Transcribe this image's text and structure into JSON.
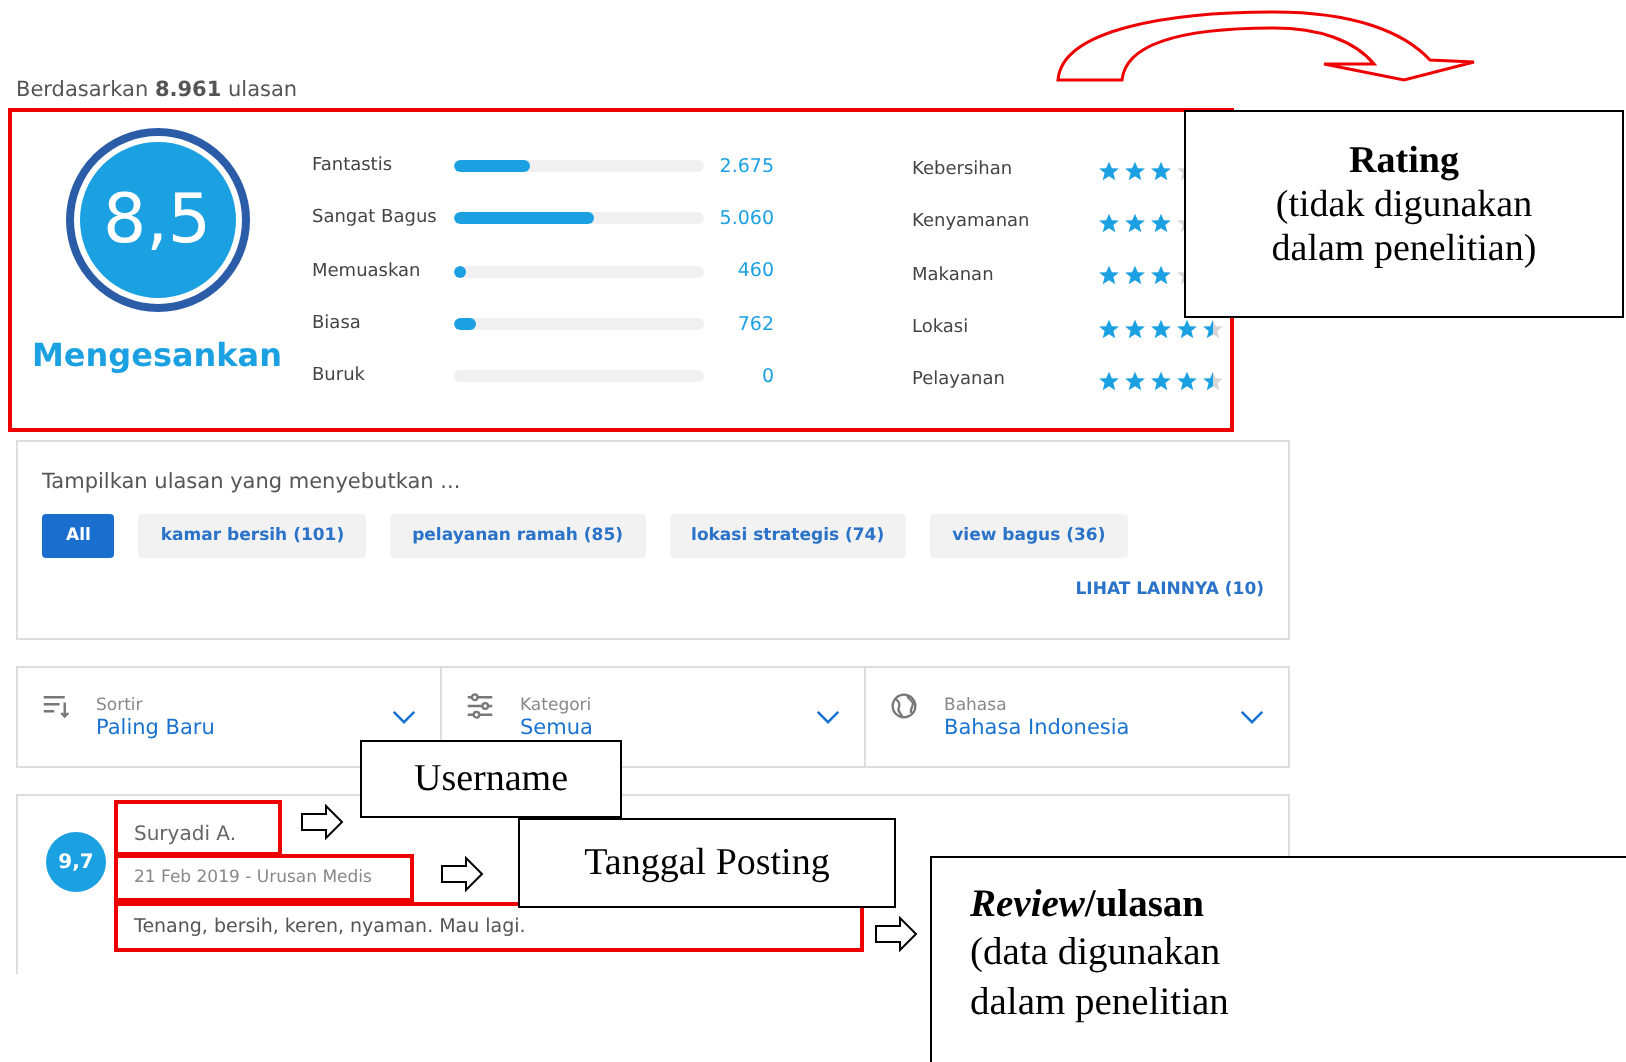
{
  "summary": "Berdasarkan **8.961** ulasan",
  "score": {
    "value": "8,5",
    "label": "Mengesankan"
  },
  "distribution": [
    {
      "label": "Fantastis",
      "level": 0.3,
      "count": "2.675"
    },
    {
      "label": "Sangat Bagus",
      "level": 0.56,
      "count": "5.060"
    },
    {
      "label": "Memuaskan",
      "level": 0.05,
      "count": "460"
    },
    {
      "label": "Biasa",
      "level": 0.085,
      "count": "762"
    },
    {
      "label": "Buruk",
      "level": 0,
      "count": "0"
    }
  ],
  "categories": [
    {
      "label": "Kebersihan",
      "stars": 3
    },
    {
      "label": "Kenyamanan",
      "stars": 3
    },
    {
      "label": "Makanan",
      "stars": 3
    },
    {
      "label": "Lokasi",
      "stars": 4.5
    },
    {
      "label": "Pelayanan",
      "stars": 4.5
    }
  ],
  "filter": {
    "title": "Tampilkan ulasan yang menyebutkan ...",
    "chips": [
      {
        "label": "All",
        "selected": true
      },
      {
        "label": "kamar bersih (101)",
        "selected": false
      },
      {
        "label": "pelayanan ramah (85)",
        "selected": false
      },
      {
        "label": "lokasi strategis (74)",
        "selected": false
      },
      {
        "label": "view bagus (36)",
        "selected": false
      }
    ],
    "more": "LIHAT LAINNYA (10)"
  },
  "dropdowns": [
    {
      "kind": "sort",
      "label": "Sortir",
      "value": "Paling Baru"
    },
    {
      "kind": "filter",
      "label": "Kategori",
      "value": "Semua"
    },
    {
      "kind": "language",
      "label": "Bahasa",
      "value": "Bahasa Indonesia"
    }
  ],
  "review": {
    "score": "9,7",
    "username": "Suryadi A.",
    "meta": "21 Feb 2019 - Urusan Medis",
    "text": "Tenang, bersih, keren, nyaman. Mau lagi."
  },
  "annotations": {
    "rating": {
      "title": "Rating",
      "lines": [
        "(tidak digunakan",
        "dalam penelitian)"
      ]
    },
    "username": {
      "title": "Username"
    },
    "date": {
      "title": "Tanggal Posting"
    },
    "review": {
      "title": "*Review*/ulasan",
      "lines": [
        "(data digunakan",
        "dalam penelitian"
      ]
    }
  }
}
